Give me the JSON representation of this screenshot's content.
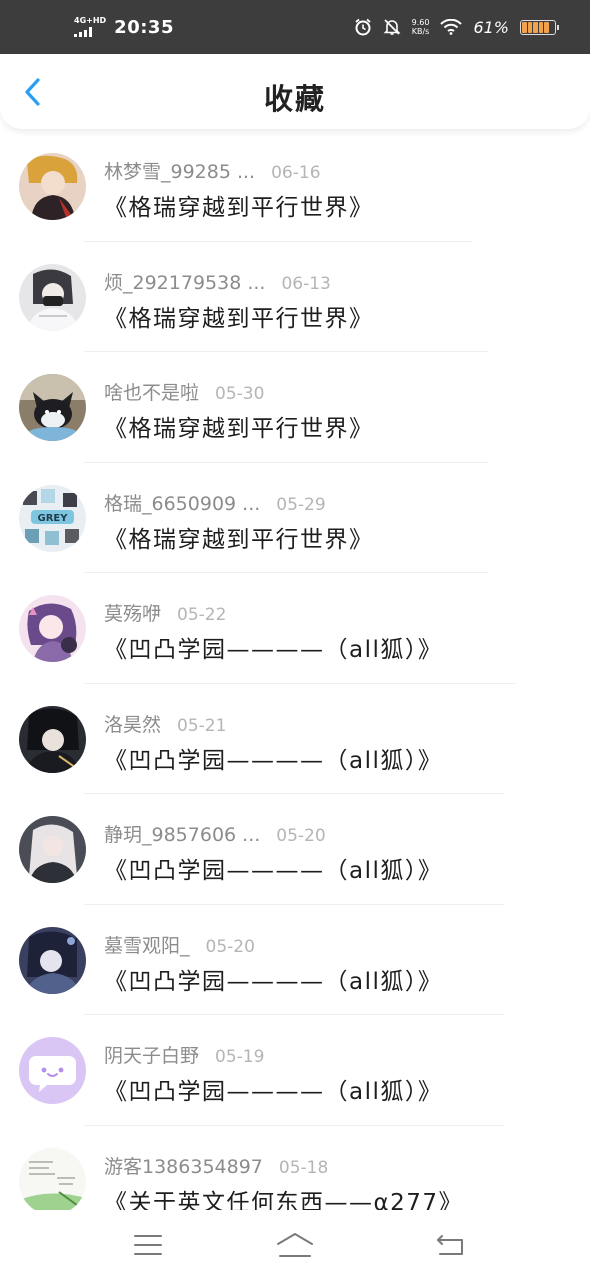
{
  "status_bar": {
    "network": "4G+HD",
    "time": "20:35",
    "speed_value": "9.60",
    "speed_unit": "KB/s",
    "battery_percent": "61%"
  },
  "header": {
    "title": "收藏",
    "back_icon": "chevron-left-icon",
    "accent_color": "#2a9df4"
  },
  "favorites": [
    {
      "author": "林梦雪_99285 ...",
      "date": "06-16",
      "title": "《格瑞穿越到平行世界》"
    },
    {
      "author": "烦_292179538 ...",
      "date": "06-13",
      "title": "《格瑞穿越到平行世界》"
    },
    {
      "author": "啥也不是啦",
      "date": "05-30",
      "title": "《格瑞穿越到平行世界》"
    },
    {
      "author": "格瑞_6650909 ...",
      "date": "05-29",
      "title": "《格瑞穿越到平行世界》"
    },
    {
      "author": "莫殇咿",
      "date": "05-22",
      "title": "《凹凸学园————（all狐）》"
    },
    {
      "author": "洛昊然",
      "date": "05-21",
      "title": "《凹凸学园————（all狐）》"
    },
    {
      "author": "静玥_9857606 ...",
      "date": "05-20",
      "title": "《凹凸学园————（all狐）》"
    },
    {
      "author": "墓雪观阳_",
      "date": "05-20",
      "title": "《凹凸学园————（all狐）》"
    },
    {
      "author": "阴天子白野",
      "date": "05-19",
      "title": "《凹凸学园————（all狐）》"
    },
    {
      "author": "游客1386354897",
      "date": "05-18",
      "title": "《关于英文任何东西——α277》"
    }
  ],
  "nav_bar": {
    "menu_icon": "menu-icon",
    "home_icon": "home-icon",
    "back_icon": "back-icon"
  }
}
